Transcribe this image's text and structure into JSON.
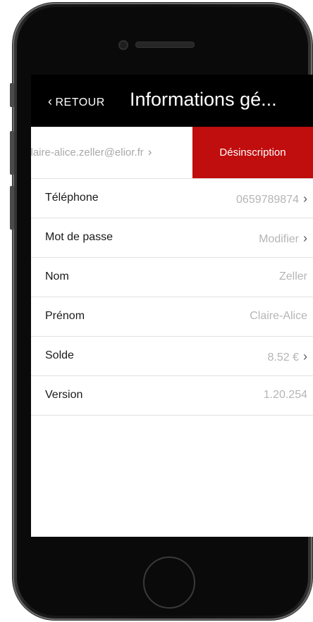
{
  "navbar": {
    "back_label": "RETOUR",
    "title": "Informations gé..."
  },
  "account": {
    "email": "claire-alice.zeller@elior.fr",
    "unsubscribe_label": "Désinscription"
  },
  "rows": [
    {
      "label": "Téléphone",
      "value": "0659789874",
      "chevron": true
    },
    {
      "label": "Mot de passe",
      "value": "Modifier",
      "chevron": true
    },
    {
      "label": "Nom",
      "value": "Zeller",
      "chevron": false
    },
    {
      "label": "Prénom",
      "value": "Claire-Alice",
      "chevron": false
    },
    {
      "label": "Solde",
      "value": "8.52 €",
      "chevron": true
    },
    {
      "label": "Version",
      "value": "1.20.254",
      "chevron": false
    }
  ],
  "colors": {
    "accent": "#c00d0d",
    "navbar": "#000000"
  }
}
